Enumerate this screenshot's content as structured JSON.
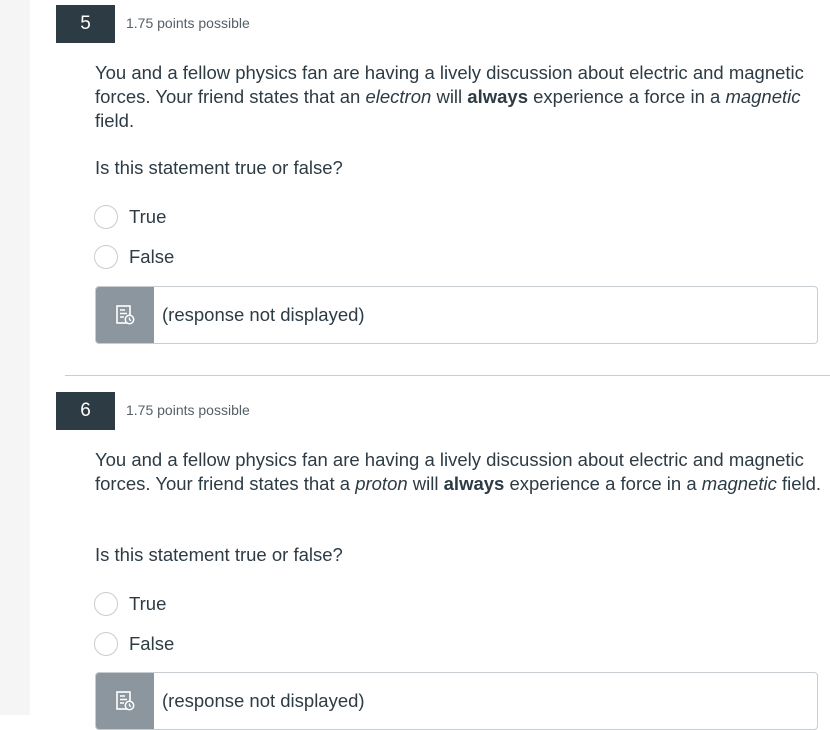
{
  "questions": [
    {
      "number": "5",
      "points": "1.75 points possible",
      "text_parts": {
        "p1": "You and a fellow physics fan are having a lively discussion about electric and magnetic forces. Your friend states that an ",
        "particle": "electron",
        "p2": " will ",
        "emphasis": "always",
        "p3": " experience a force in a ",
        "field": "magnetic",
        "p4": " field."
      },
      "prompt": "Is this statement true or false?",
      "options": [
        "True",
        "False"
      ],
      "response": "(response not displayed)"
    },
    {
      "number": "6",
      "points": "1.75 points possible",
      "text_parts": {
        "p1": "You and a fellow physics fan are having a lively discussion about electric and magnetic forces. Your friend states that a ",
        "particle": "proton",
        "p2": " will ",
        "emphasis": "always",
        "p3": " experience a force in a ",
        "field": "magnetic",
        "p4": " field."
      },
      "prompt": "Is this statement true or false?",
      "options": [
        "True",
        "False"
      ],
      "response": "(response not displayed)"
    }
  ],
  "icons": {
    "response": "document-clock-icon"
  },
  "colors": {
    "number_badge": "#2d3b45",
    "response_icon_bg": "#8b969e",
    "border": "#c7cdd1"
  }
}
